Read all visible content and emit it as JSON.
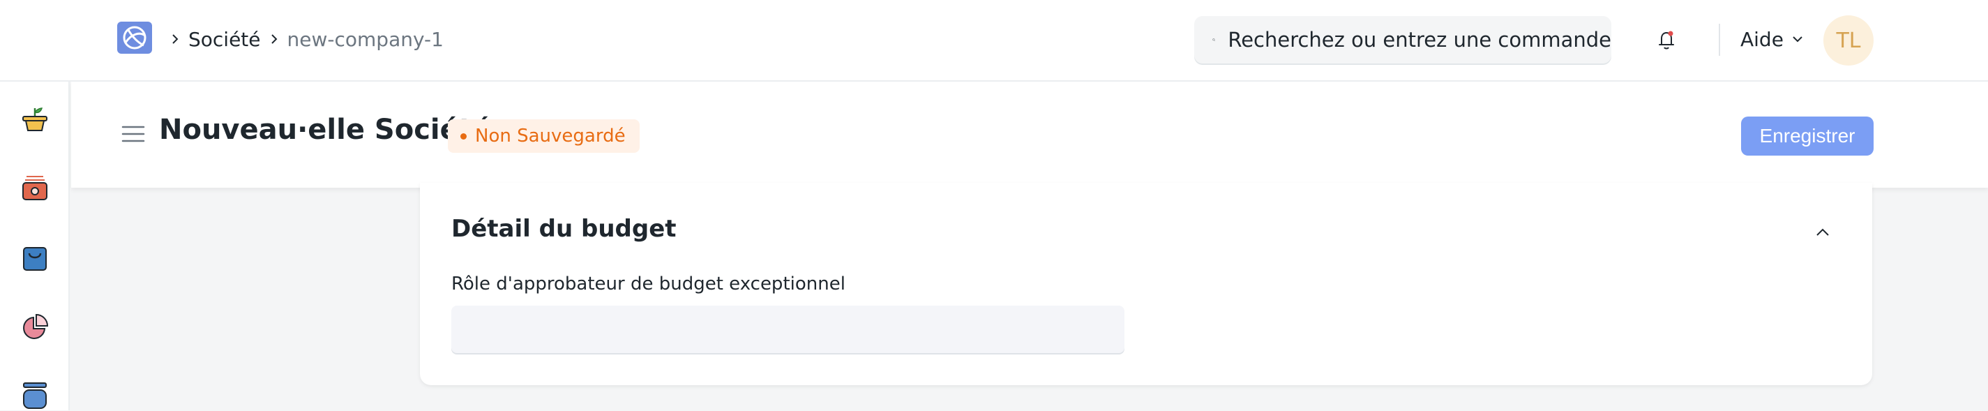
{
  "breadcrumb": {
    "parent": "Société",
    "current": "new-company-1"
  },
  "search": {
    "placeholder": "Recherchez ou entrez une commande"
  },
  "navbar": {
    "help_label": "Aide",
    "avatar_initials": "TL"
  },
  "page": {
    "title": "Nouveau·elle Société",
    "status": "Non Sauvegardé",
    "save_label": "Enregistrer"
  },
  "section": {
    "title": "Détail du budget",
    "field_label": "Rôle d'approbateur de budget exceptionnel",
    "field_value": ""
  },
  "icons": {
    "logo": "app-logo-icon",
    "search": "search-icon",
    "notifications": "bell-icon",
    "menu": "hamburger-icon",
    "collapse": "chevron-up-icon"
  },
  "colors": {
    "primary_button": "#7b9ef4",
    "status_text": "#e86c13",
    "status_bg": "#fff1e7",
    "avatar_bg": "#fcf0dc",
    "avatar_text": "#d6a352"
  }
}
